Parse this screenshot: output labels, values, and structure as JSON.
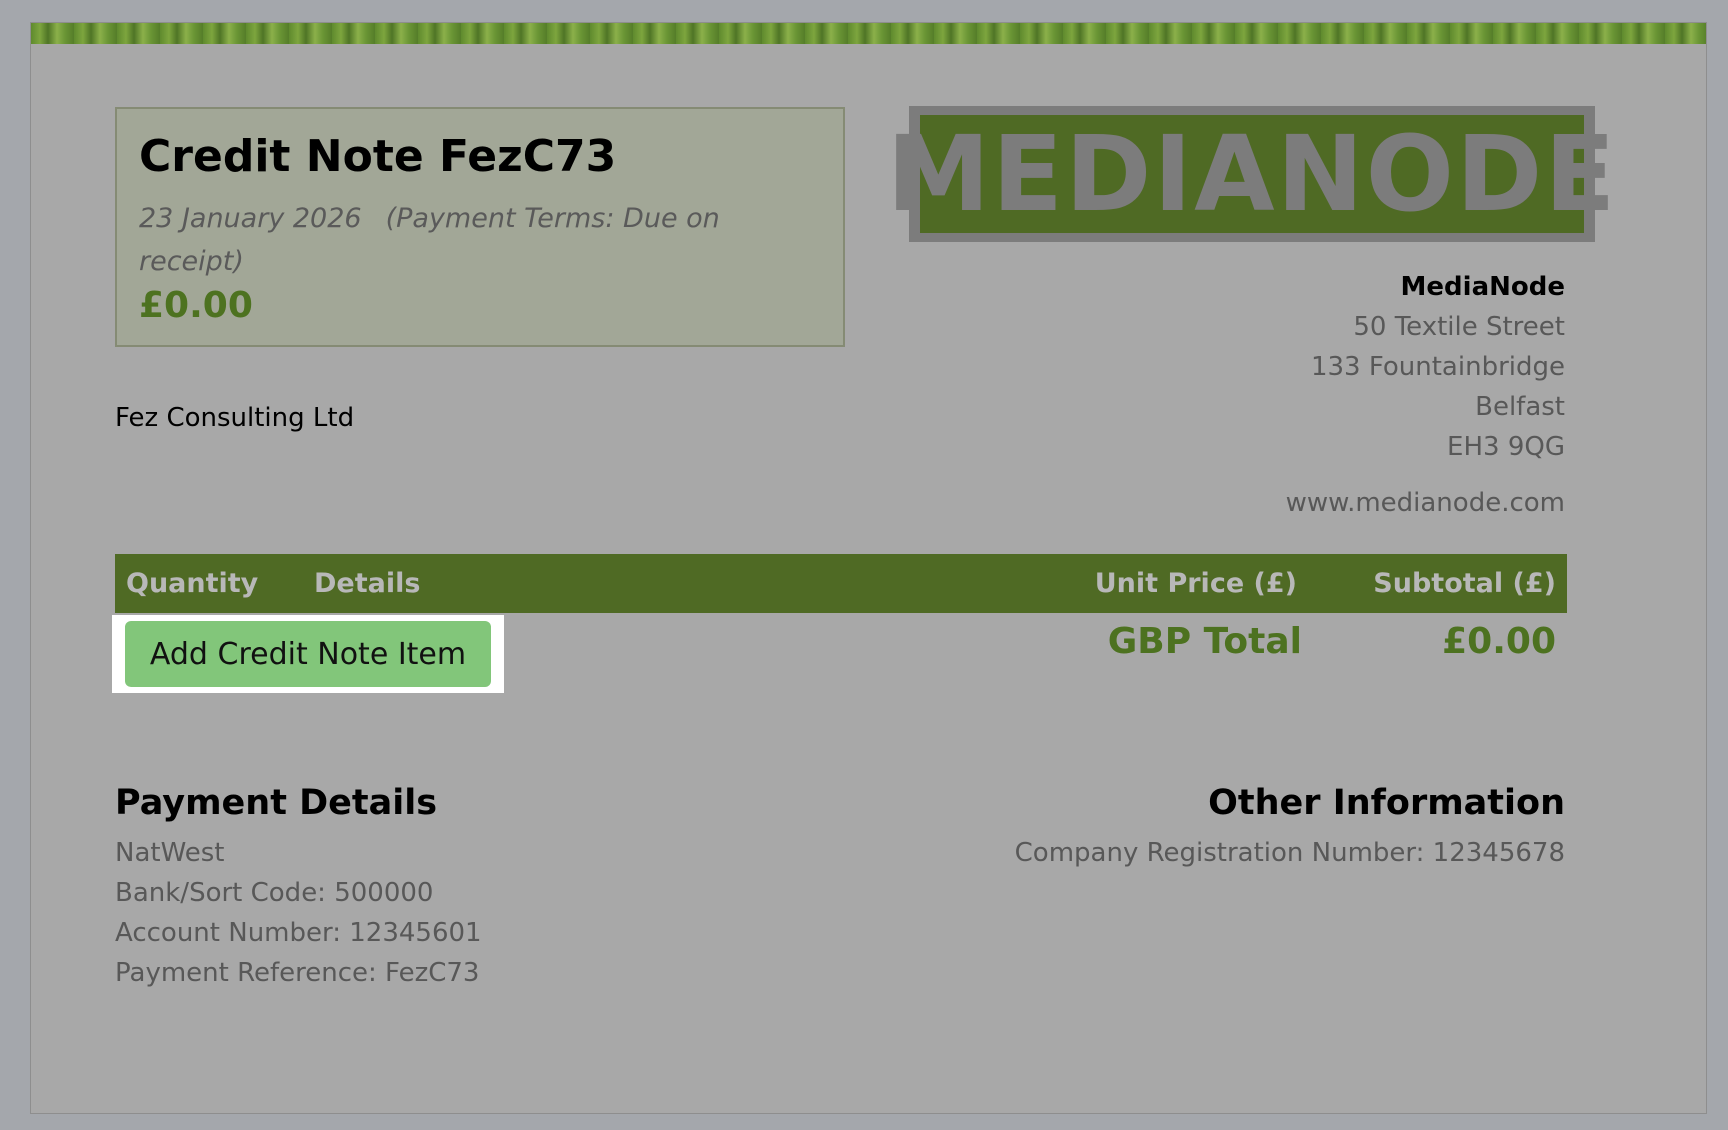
{
  "credit_note": {
    "title": "Credit Note FezC73",
    "date": "23 January 2026",
    "terms": "(Payment Terms: Due on receipt)",
    "amount": "£0.00"
  },
  "logo": {
    "text": "MEDIANODE"
  },
  "company": {
    "name": "MediaNode",
    "address": [
      "50 Textile Street",
      "133 Fountainbridge",
      "Belfast",
      "EH3 9QG"
    ],
    "website": "www.medianode.com"
  },
  "client": {
    "name": "Fez Consulting Ltd"
  },
  "table": {
    "headers": {
      "quantity": "Quantity",
      "details": "Details",
      "unit_price": "Unit Price (£)",
      "subtotal": "Subtotal (£)"
    },
    "add_button_label": "Add Credit Note Item",
    "total_label": "GBP Total",
    "total_amount": "£0.00"
  },
  "payment_details": {
    "title": "Payment Details",
    "bank": "NatWest",
    "sort_code": "Bank/Sort Code: 500000",
    "account_number": "Account Number: 12345601",
    "reference": "Payment Reference: FezC73"
  },
  "other_information": {
    "title": "Other Information",
    "registration": "Company Registration Number: 12345678"
  },
  "colors": {
    "accent_green": "#4f6a24",
    "amount_green": "#4d7220",
    "button_green": "#82c67a"
  }
}
